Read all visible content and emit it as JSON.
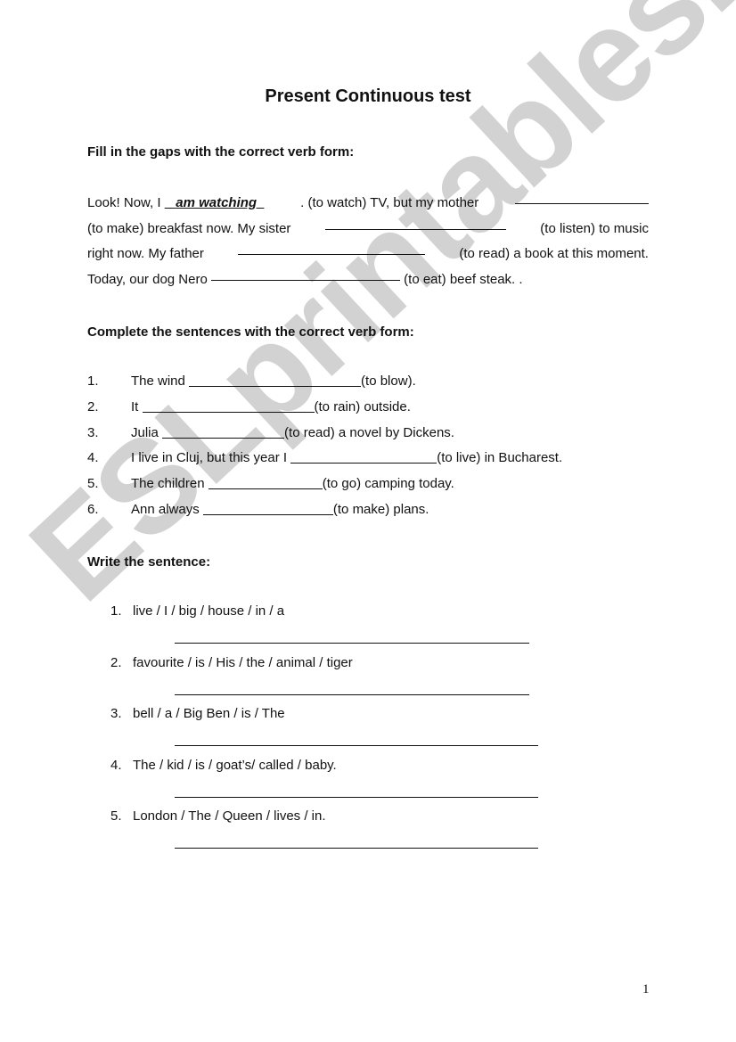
{
  "title": "Present Continuous test",
  "watermark": "ESLprintables.com",
  "section1": {
    "heading": "Fill in the gaps with the correct verb form:",
    "lines": [
      {
        "a": "Look! Now, I ",
        "answer": "am watching",
        "b": ". (to watch) TV, but my mother"
      },
      {
        "a": "(to make) breakfast now. My sister",
        "b": "(to listen) to music"
      },
      {
        "a": "right now. My father",
        "b": "(to read) a book at this moment."
      },
      {
        "a": "Today, our dog Nero",
        "b": "(to eat) beef steak. ."
      }
    ]
  },
  "section2": {
    "heading": "Complete the sentences with the correct verb form:",
    "items": [
      {
        "num": "1.",
        "before": "The wind ",
        "after": " (to blow)."
      },
      {
        "num": "2.",
        "before": "It ",
        "after": " (to rain) outside."
      },
      {
        "num": "3.",
        "before": "Julia ",
        "after": " (to read) a novel by Dickens."
      },
      {
        "num": "4.",
        "before": "I live in Cluj, but this year I ",
        "after": " (to live) in Bucharest."
      },
      {
        "num": "5.",
        "before": "The children ",
        "after": " (to go) camping today."
      },
      {
        "num": "6.",
        "before": "Ann always ",
        "after": " (to make) plans."
      }
    ]
  },
  "section3": {
    "heading": "Write the sentence:",
    "items": [
      {
        "num": "1.",
        "words": "live / I / big / house / in / a"
      },
      {
        "num": "2.",
        "words": "favourite / is / His / the / animal / tiger"
      },
      {
        "num": "3.",
        "words": "bell / a / Big Ben / is / The"
      },
      {
        "num": "4.",
        "words": "The / kid / is / goat’s/ called / baby."
      },
      {
        "num": "5.",
        "words": "London / The / Queen / lives / in."
      }
    ]
  },
  "page_number": "1"
}
